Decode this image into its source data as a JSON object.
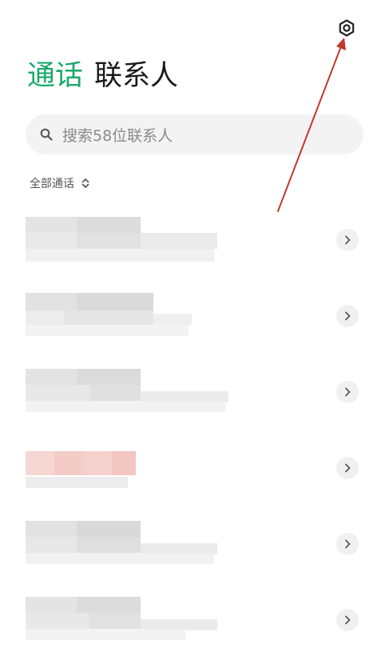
{
  "tabs": [
    {
      "label": "通话",
      "active": true
    },
    {
      "label": "联系人",
      "active": false
    }
  ],
  "search": {
    "placeholder": "搜索58位联系人"
  },
  "filter": {
    "label": "全部通话"
  },
  "colors": {
    "accent": "#1aa96b",
    "annotation": "#c0392b",
    "highlight": "#f4c7c3"
  },
  "icons": {
    "settings": "settings-gear-icon",
    "search": "search-icon",
    "sort": "sort-updown-icon",
    "chevron": "chevron-right-icon"
  },
  "call_rows": [
    {
      "name": "",
      "detail": "",
      "blurred": true,
      "highlight": false
    },
    {
      "name": "",
      "detail": "",
      "blurred": true,
      "highlight": false
    },
    {
      "name": "",
      "detail": "",
      "blurred": true,
      "highlight": false
    },
    {
      "name": "",
      "detail": "",
      "blurred": true,
      "highlight": true
    },
    {
      "name": "",
      "detail": "",
      "blurred": true,
      "highlight": false
    },
    {
      "name": "",
      "detail": "",
      "blurred": true,
      "highlight": false
    }
  ]
}
